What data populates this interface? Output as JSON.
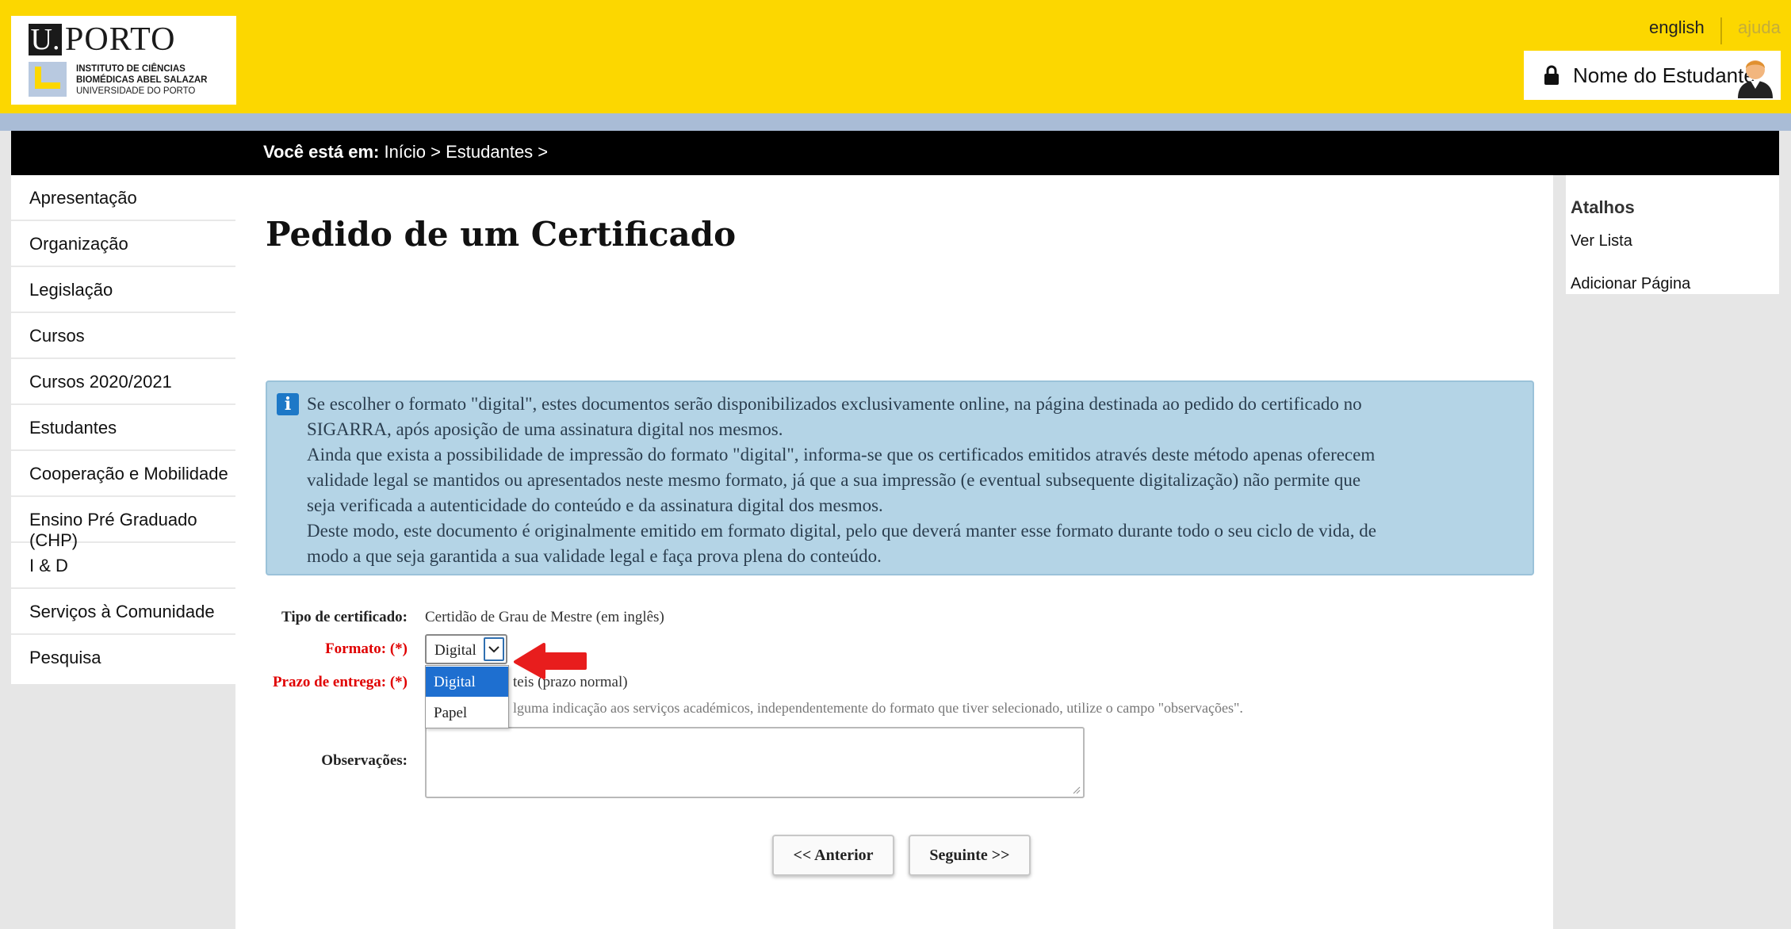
{
  "header": {
    "logo": {
      "u": "U.",
      "porto": "PORTO",
      "institute_line1": "INSTITUTO DE CIÊNCIAS",
      "institute_line2": "BIOMÉDICAS ABEL SALAZAR",
      "university": "UNIVERSIDADE DO PORTO"
    },
    "lang_english": "english",
    "help": "ajuda",
    "user_name": "Nome do Estudante",
    "colors": {
      "bar": "#fcd700",
      "accent_blue": "#1e6fd0"
    }
  },
  "breadcrumb": {
    "prefix": "Você está em:",
    "path": " Início > Estudantes >"
  },
  "sidebar": {
    "items": [
      {
        "label": "Apresentação"
      },
      {
        "label": "Organização"
      },
      {
        "label": "Legislação"
      },
      {
        "label": "Cursos"
      },
      {
        "label": "Cursos 2020/2021"
      },
      {
        "label": "Estudantes"
      },
      {
        "label": "Cooperação e Mobilidade"
      },
      {
        "label": "Ensino Pré Graduado (CHP)"
      },
      {
        "label": "I & D"
      },
      {
        "label": "Serviços à Comunidade"
      },
      {
        "label": "Pesquisa"
      }
    ]
  },
  "main": {
    "title": "Pedido de um Certificado",
    "info_icon": "info-icon",
    "info_text": [
      "Se escolher o formato \"digital\", estes documentos serão disponibilizados exclusivamente online, na página destinada ao pedido do certificado no",
      "SIGARRA, após aposição de uma assinatura digital nos mesmos.",
      "Ainda que exista a possibilidade de impressão do formato \"digital\", informa-se que os certificados emitidos através deste método apenas oferecem",
      "validade legal se mantidos ou apresentados neste mesmo formato, já que a sua impressão (e eventual subsequente digitalização) não permite que",
      "seja verificada a autenticidade do conteúdo e da assinatura digital dos mesmos.",
      "Deste modo, este documento é originalmente emitido em formato digital, pelo que deverá manter esse formato durante todo o seu ciclo de vida, de",
      "modo a que seja garantida a sua validade legal e faça prova plena do conteúdo."
    ],
    "form": {
      "tipo_label": "Tipo de certificado:",
      "tipo_value": "Certidão de Grau de Mestre (em inglês)",
      "formato_label": "Formato: (*)",
      "formato_selected": "Digital",
      "formato_options": [
        "Digital",
        "Papel"
      ],
      "prazo_label": "Prazo de entrega: (*)",
      "prazo_value_visible": "teis (prazo normal)",
      "help_visible": "lguma indicação aos serviços académicos, independentemente do formato que tiver selecionado, utilize o campo \"observações\".",
      "obs_label": "Observações:",
      "obs_value": ""
    },
    "buttons": {
      "prev": "<< Anterior",
      "next": "Seguinte >>"
    }
  },
  "right": {
    "heading": "Atalhos",
    "links": [
      "Ver Lista",
      "Adicionar Página"
    ]
  }
}
